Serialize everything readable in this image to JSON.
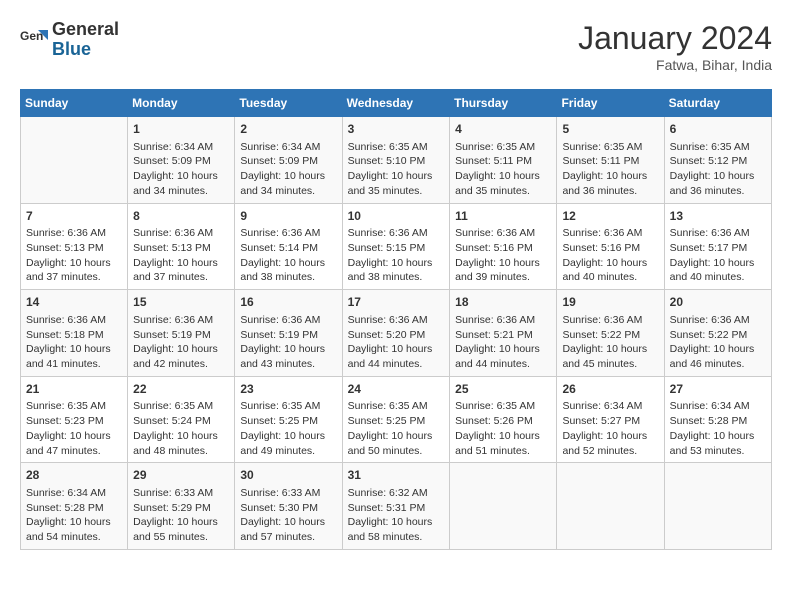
{
  "logo": {
    "line1": "General",
    "line2": "Blue"
  },
  "title": "January 2024",
  "subtitle": "Fatwa, Bihar, India",
  "days_header": [
    "Sunday",
    "Monday",
    "Tuesday",
    "Wednesday",
    "Thursday",
    "Friday",
    "Saturday"
  ],
  "weeks": [
    [
      {
        "day": "",
        "content": ""
      },
      {
        "day": "1",
        "content": "Sunrise: 6:34 AM\nSunset: 5:09 PM\nDaylight: 10 hours\nand 34 minutes."
      },
      {
        "day": "2",
        "content": "Sunrise: 6:34 AM\nSunset: 5:09 PM\nDaylight: 10 hours\nand 34 minutes."
      },
      {
        "day": "3",
        "content": "Sunrise: 6:35 AM\nSunset: 5:10 PM\nDaylight: 10 hours\nand 35 minutes."
      },
      {
        "day": "4",
        "content": "Sunrise: 6:35 AM\nSunset: 5:11 PM\nDaylight: 10 hours\nand 35 minutes."
      },
      {
        "day": "5",
        "content": "Sunrise: 6:35 AM\nSunset: 5:11 PM\nDaylight: 10 hours\nand 36 minutes."
      },
      {
        "day": "6",
        "content": "Sunrise: 6:35 AM\nSunset: 5:12 PM\nDaylight: 10 hours\nand 36 minutes."
      }
    ],
    [
      {
        "day": "7",
        "content": "Sunrise: 6:36 AM\nSunset: 5:13 PM\nDaylight: 10 hours\nand 37 minutes."
      },
      {
        "day": "8",
        "content": "Sunrise: 6:36 AM\nSunset: 5:13 PM\nDaylight: 10 hours\nand 37 minutes."
      },
      {
        "day": "9",
        "content": "Sunrise: 6:36 AM\nSunset: 5:14 PM\nDaylight: 10 hours\nand 38 minutes."
      },
      {
        "day": "10",
        "content": "Sunrise: 6:36 AM\nSunset: 5:15 PM\nDaylight: 10 hours\nand 38 minutes."
      },
      {
        "day": "11",
        "content": "Sunrise: 6:36 AM\nSunset: 5:16 PM\nDaylight: 10 hours\nand 39 minutes."
      },
      {
        "day": "12",
        "content": "Sunrise: 6:36 AM\nSunset: 5:16 PM\nDaylight: 10 hours\nand 40 minutes."
      },
      {
        "day": "13",
        "content": "Sunrise: 6:36 AM\nSunset: 5:17 PM\nDaylight: 10 hours\nand 40 minutes."
      }
    ],
    [
      {
        "day": "14",
        "content": "Sunrise: 6:36 AM\nSunset: 5:18 PM\nDaylight: 10 hours\nand 41 minutes."
      },
      {
        "day": "15",
        "content": "Sunrise: 6:36 AM\nSunset: 5:19 PM\nDaylight: 10 hours\nand 42 minutes."
      },
      {
        "day": "16",
        "content": "Sunrise: 6:36 AM\nSunset: 5:19 PM\nDaylight: 10 hours\nand 43 minutes."
      },
      {
        "day": "17",
        "content": "Sunrise: 6:36 AM\nSunset: 5:20 PM\nDaylight: 10 hours\nand 44 minutes."
      },
      {
        "day": "18",
        "content": "Sunrise: 6:36 AM\nSunset: 5:21 PM\nDaylight: 10 hours\nand 44 minutes."
      },
      {
        "day": "19",
        "content": "Sunrise: 6:36 AM\nSunset: 5:22 PM\nDaylight: 10 hours\nand 45 minutes."
      },
      {
        "day": "20",
        "content": "Sunrise: 6:36 AM\nSunset: 5:22 PM\nDaylight: 10 hours\nand 46 minutes."
      }
    ],
    [
      {
        "day": "21",
        "content": "Sunrise: 6:35 AM\nSunset: 5:23 PM\nDaylight: 10 hours\nand 47 minutes."
      },
      {
        "day": "22",
        "content": "Sunrise: 6:35 AM\nSunset: 5:24 PM\nDaylight: 10 hours\nand 48 minutes."
      },
      {
        "day": "23",
        "content": "Sunrise: 6:35 AM\nSunset: 5:25 PM\nDaylight: 10 hours\nand 49 minutes."
      },
      {
        "day": "24",
        "content": "Sunrise: 6:35 AM\nSunset: 5:25 PM\nDaylight: 10 hours\nand 50 minutes."
      },
      {
        "day": "25",
        "content": "Sunrise: 6:35 AM\nSunset: 5:26 PM\nDaylight: 10 hours\nand 51 minutes."
      },
      {
        "day": "26",
        "content": "Sunrise: 6:34 AM\nSunset: 5:27 PM\nDaylight: 10 hours\nand 52 minutes."
      },
      {
        "day": "27",
        "content": "Sunrise: 6:34 AM\nSunset: 5:28 PM\nDaylight: 10 hours\nand 53 minutes."
      }
    ],
    [
      {
        "day": "28",
        "content": "Sunrise: 6:34 AM\nSunset: 5:28 PM\nDaylight: 10 hours\nand 54 minutes."
      },
      {
        "day": "29",
        "content": "Sunrise: 6:33 AM\nSunset: 5:29 PM\nDaylight: 10 hours\nand 55 minutes."
      },
      {
        "day": "30",
        "content": "Sunrise: 6:33 AM\nSunset: 5:30 PM\nDaylight: 10 hours\nand 57 minutes."
      },
      {
        "day": "31",
        "content": "Sunrise: 6:32 AM\nSunset: 5:31 PM\nDaylight: 10 hours\nand 58 minutes."
      },
      {
        "day": "",
        "content": ""
      },
      {
        "day": "",
        "content": ""
      },
      {
        "day": "",
        "content": ""
      }
    ]
  ]
}
